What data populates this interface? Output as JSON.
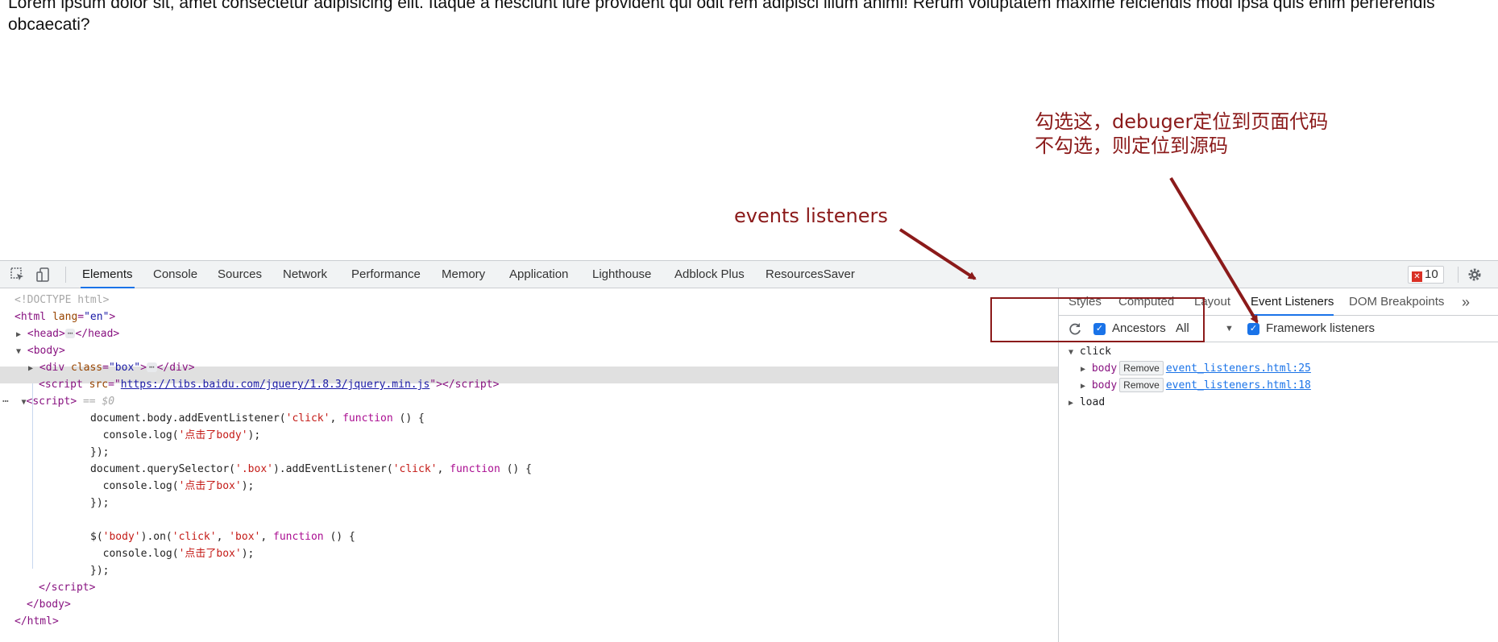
{
  "page": {
    "line1": "Lorem ipsum dolor sit, amet consectetur adipisicing elit. Itaque a nesciunt iure provident qui odit rem adipisci illum animi! Rerum voluptatem maxime reiciendis modi ipsa quis enim perferendis",
    "line2": "obcaecati?"
  },
  "annotations": {
    "events": "events listeners",
    "tip_line1": "勾选这，debuger定位到页面代码",
    "tip_line2": "不勾选，则定位到源码"
  },
  "toolbar": {
    "inspect_icon": "inspect-element-icon",
    "device_icon": "device-toolbar-icon",
    "tabs": [
      "Elements",
      "Console",
      "Sources",
      "Network",
      "Performance",
      "Memory",
      "Application",
      "Lighthouse",
      "Adblock Plus",
      "ResourcesSaver"
    ],
    "active_tab": "Elements",
    "error_count": "10",
    "settings_icon": "gear-icon"
  },
  "elements": {
    "doctype": "<!DOCTYPE html>",
    "html_open_tag": "html",
    "html_lang_attr": "lang",
    "html_lang_val": "\"en\"",
    "head_tag": "head",
    "body_tag": "body",
    "div_tag": "div",
    "div_class_attr": "class",
    "div_class_val": "\"box\"",
    "script_tag": "script",
    "script_src_attr": "src",
    "script_src_val": "https://libs.baidu.com/jquery/1.8.3/jquery.min.js",
    "selected_marker": "== $0",
    "ellipsis": "⋯",
    "code": {
      "l1_pre": "document.body.addEventListener(",
      "l1_str": "'click'",
      "l1_mid": ", ",
      "l1_kw": "function",
      "l1_post": " () {",
      "l2_pre": "  console.log(",
      "l2_str": "'点击了body'",
      "l2_post": ");",
      "l3": "});",
      "l4_pre": "document.querySelector(",
      "l4_str1": "'.box'",
      "l4_mid1": ").addEventListener(",
      "l4_str2": "'click'",
      "l4_mid2": ", ",
      "l4_kw": "function",
      "l4_post": " () {",
      "l5_pre": "  console.log(",
      "l5_str": "'点击了box'",
      "l5_post": ");",
      "l6": "});",
      "l7_pre": "$(",
      "l7_str1": "'body'",
      "l7_mid1": ").on(",
      "l7_str2": "'click'",
      "l7_mid2": ", ",
      "l7_str3": "'box'",
      "l7_mid3": ", ",
      "l7_kw": "function",
      "l7_post": " () {",
      "l8_pre": "  console.log(",
      "l8_str": "'点击了box'",
      "l8_post": ");",
      "l9": "});"
    }
  },
  "sidebar": {
    "tabs": [
      "Styles",
      "Computed",
      "Layout",
      "Event Listeners",
      "DOM Breakpoints"
    ],
    "active_tab": "Event Listeners",
    "more_icon": "chevron-double-right-icon",
    "refresh_icon": "refresh-icon",
    "ancestors_label": "Ancestors",
    "ancestors_checked": true,
    "filter_value": "All",
    "framework_label": "Framework listeners",
    "framework_checked": true,
    "events": [
      {
        "name": "click",
        "expanded": true,
        "listeners": [
          {
            "node": "body",
            "remove": "Remove",
            "source": "event_listeners.html:25"
          },
          {
            "node": "body",
            "remove": "Remove",
            "source": "event_listeners.html:18"
          }
        ]
      },
      {
        "name": "load",
        "expanded": false,
        "listeners": []
      }
    ]
  },
  "colors": {
    "annotation": "#8b1a1a",
    "accent": "#1a73e8",
    "tag": "#881280",
    "string": "#c41a16",
    "keyword": "#aa0d91"
  }
}
